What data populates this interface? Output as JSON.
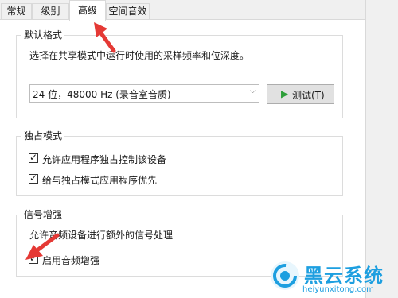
{
  "tabs": [
    {
      "label": "常规",
      "active": false
    },
    {
      "label": "级别",
      "active": false
    },
    {
      "label": "高级",
      "active": true
    },
    {
      "label": "空间音效",
      "active": false
    }
  ],
  "default_format": {
    "legend": "默认格式",
    "description": "选择在共享模式中运行时使用的采样频率和位深度。",
    "selected": "24 位，48000 Hz (录音室音质)",
    "test_button": "测试(T)"
  },
  "exclusive": {
    "legend": "独占模式",
    "options": [
      {
        "label": "允许应用程序独占控制该设备",
        "checked": true
      },
      {
        "label": "给与独占模式应用程序优先",
        "checked": true
      }
    ]
  },
  "enhancement": {
    "legend": "信号增强",
    "description": "允许音频设备进行额外的信号处理",
    "option": {
      "label": "启用音频增强",
      "checked": true
    }
  },
  "watermark": {
    "title": "黑云系统",
    "url": "heiyunxitong.com"
  },
  "colors": {
    "arrow": "#e53935",
    "play": "#2e9f3a",
    "brand": "#1d9fe0"
  }
}
